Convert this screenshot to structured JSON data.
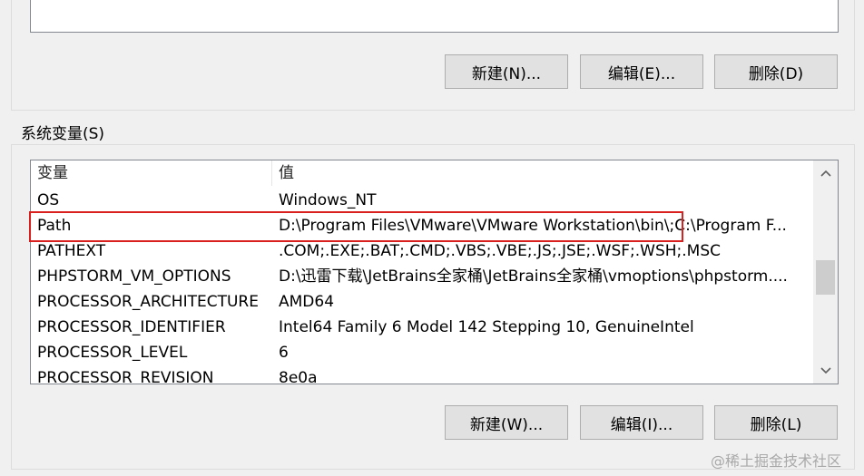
{
  "user_section": {
    "buttons": {
      "new": "新建(N)...",
      "edit": "编辑(E)...",
      "delete": "删除(D)"
    }
  },
  "system_section": {
    "title": "系统变量(S)",
    "columns": {
      "name": "变量",
      "value": "值"
    },
    "rows": [
      {
        "name": "OS",
        "value": "Windows_NT"
      },
      {
        "name": "Path",
        "value": "D:\\Program Files\\VMware\\VMware Workstation\\bin\\;C:\\Program F..."
      },
      {
        "name": "PATHEXT",
        "value": ".COM;.EXE;.BAT;.CMD;.VBS;.VBE;.JS;.JSE;.WSF;.WSH;.MSC"
      },
      {
        "name": "PHPSTORM_VM_OPTIONS",
        "value": "D:\\迅雷下载\\JetBrains全家桶\\JetBrains全家桶\\vmoptions\\phpstorm...."
      },
      {
        "name": "PROCESSOR_ARCHITECTURE",
        "value": "AMD64"
      },
      {
        "name": "PROCESSOR_IDENTIFIER",
        "value": "Intel64 Family 6 Model 142 Stepping 10, GenuineIntel"
      },
      {
        "name": "PROCESSOR_LEVEL",
        "value": "6"
      },
      {
        "name": "PROCESSOR_REVISION",
        "value": "8e0a"
      }
    ],
    "buttons": {
      "new": "新建(W)...",
      "edit": "编辑(I)...",
      "delete": "删除(L)"
    }
  },
  "annotation": {
    "highlight_color": "#d9201e",
    "highlighted_row": "Path"
  },
  "watermark": "@稀土掘金技术社区",
  "icons": {
    "scroll_up": "chevron-up-icon",
    "scroll_down": "chevron-down-icon"
  }
}
